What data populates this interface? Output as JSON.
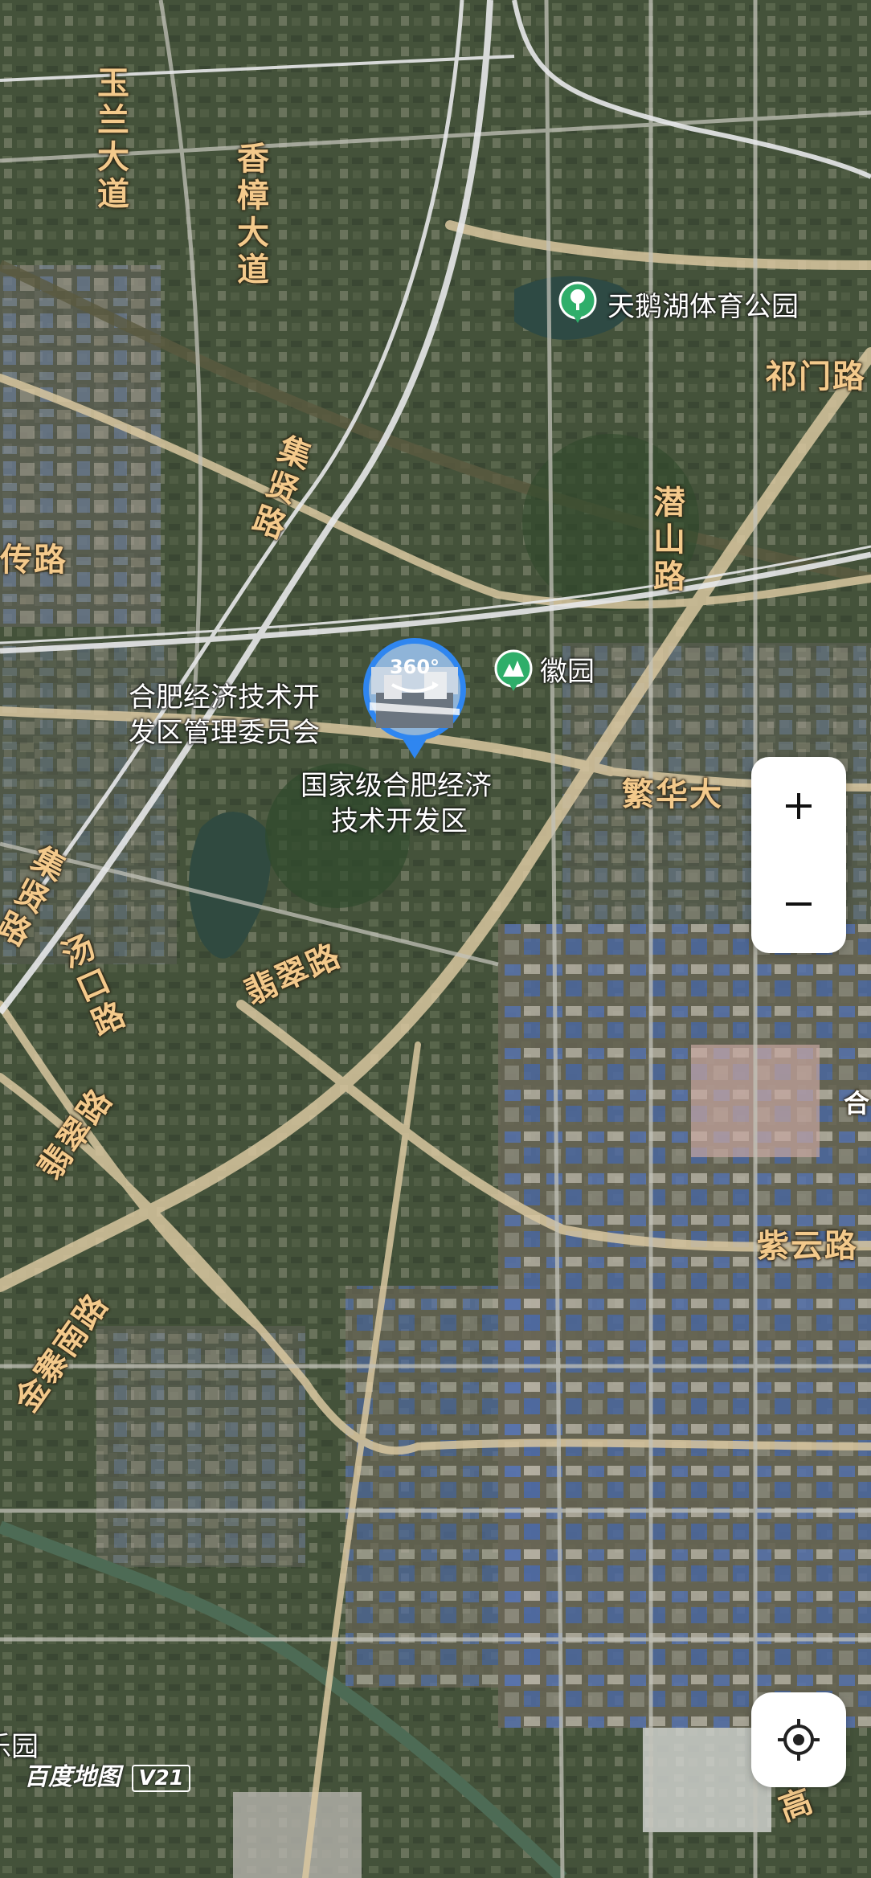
{
  "map": {
    "type": "satellite",
    "logo_text": "百度地图",
    "logo_version": "V21"
  },
  "roads": {
    "yulan_dadao": "玉兰大道",
    "xiangzhang_dadao": "香樟大道",
    "jixian_lu": "集贤路",
    "chuan_lu": "传路",
    "qimen_lu": "祁门路",
    "qianshan_lu": "潜山路",
    "fanhua_da": "繁华大",
    "feicui_lu": "翡翠路",
    "tangkou_lu": "汤口路",
    "feicui_lu_2": "翡翠路",
    "jixian_lu_2": "集贤路",
    "ziyun_lu": "紫云路",
    "jinzhai_nanlu": "金寨南路",
    "he_edge": "合",
    "gao_edge": "高",
    "yuan_edge": "乐园"
  },
  "pois": {
    "tiane_park": "天鹅湖体育公园",
    "huiyuan": "徽园",
    "committee_line1": "合肥经济技术开",
    "committee_line2": "发区管理委员会",
    "devzone_line1": "国家级合肥经济",
    "devzone_line2": "技术开发区",
    "pano_badge": "360°"
  },
  "controls": {
    "zoom_in": "+",
    "zoom_out": "−"
  },
  "colors": {
    "road_label": "#f3c98b",
    "poi_green": "#2fae6a",
    "pano_blue": "#2f86f0"
  }
}
